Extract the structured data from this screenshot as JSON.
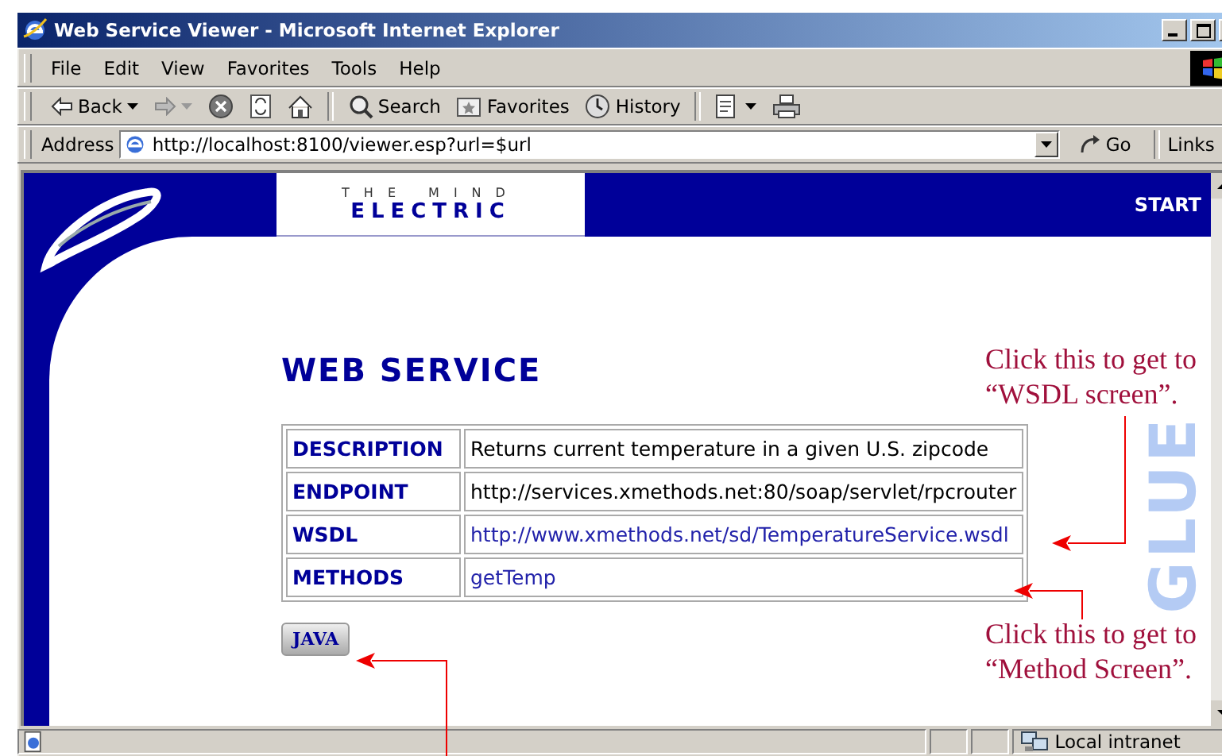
{
  "window": {
    "title": "Web Service Viewer - Microsoft Internet Explorer"
  },
  "menu": [
    "File",
    "Edit",
    "View",
    "Favorites",
    "Tools",
    "Help"
  ],
  "toolbar": [
    {
      "kind": "back",
      "label": "Back"
    },
    {
      "kind": "forward"
    },
    {
      "kind": "stop"
    },
    {
      "kind": "refresh"
    },
    {
      "kind": "home"
    },
    {
      "kind": "search",
      "label": "Search"
    },
    {
      "kind": "favorites",
      "label": "Favorites"
    },
    {
      "kind": "history",
      "label": "History"
    },
    {
      "kind": "edit"
    },
    {
      "kind": "print"
    }
  ],
  "address": {
    "label": "Address",
    "value": "http://localhost:8100/viewer.esp?url=$url",
    "go": "Go",
    "links": "Links"
  },
  "page": {
    "logo_top": "THE MIND",
    "logo_bottom": "ELECTRIC",
    "nav": "START",
    "watermark": "GLUE",
    "heading": "WEB SERVICE",
    "rows": [
      {
        "label": "DESCRIPTION",
        "value": "Returns current temperature in a given U.S. zipcode",
        "kind": "text"
      },
      {
        "label": "ENDPOINT",
        "value": "http://services.xmethods.net:80/soap/servlet/rpcrouter",
        "kind": "text"
      },
      {
        "label": "WSDL",
        "value": "http://www.xmethods.net/sd/TemperatureService.wsdl",
        "kind": "link"
      },
      {
        "label": "METHODS",
        "value": "getTemp",
        "kind": "link"
      }
    ],
    "button": "JAVA"
  },
  "annotations": [
    {
      "lines": [
        "Click this to get to",
        "“WSDL screen”."
      ]
    },
    {
      "lines": [
        "Click this to get to",
        "“Method Screen”."
      ]
    }
  ],
  "status_bar": {
    "zone": "Local intranet"
  }
}
